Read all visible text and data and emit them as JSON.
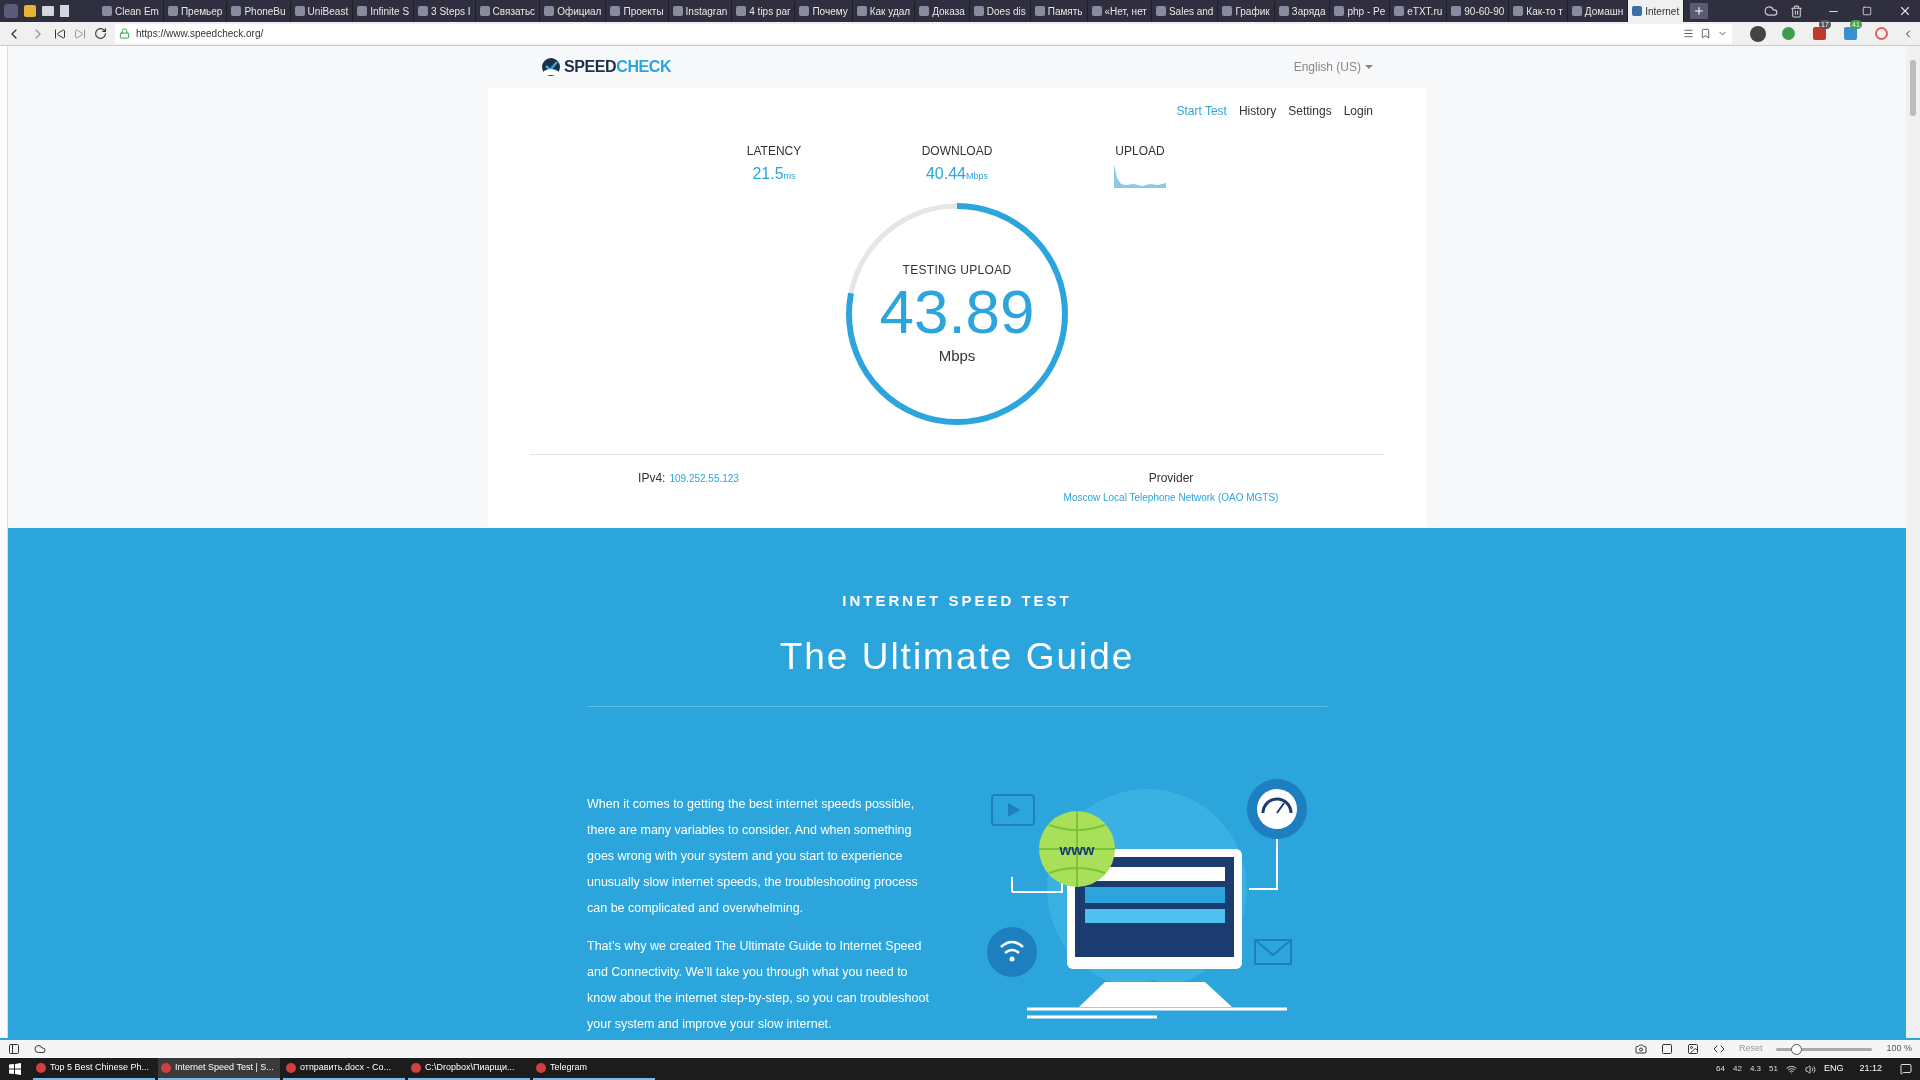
{
  "browser": {
    "tabs": [
      {
        "title": "Clean Em",
        "selected": false
      },
      {
        "title": "Премьер",
        "selected": false
      },
      {
        "title": "PhoneBu",
        "selected": false
      },
      {
        "title": "UniBeast",
        "selected": false
      },
      {
        "title": "Infinite S",
        "selected": false
      },
      {
        "title": "3 Steps I",
        "selected": false
      },
      {
        "title": "Связатьс",
        "selected": false
      },
      {
        "title": "Официал",
        "selected": false
      },
      {
        "title": "Проекты",
        "selected": false
      },
      {
        "title": "Instagran",
        "selected": false
      },
      {
        "title": "4 tips par",
        "selected": false
      },
      {
        "title": "Почему",
        "selected": false
      },
      {
        "title": "Как удал",
        "selected": false
      },
      {
        "title": "Доказа",
        "selected": false
      },
      {
        "title": "Does dis",
        "selected": false
      },
      {
        "title": "Память",
        "selected": false
      },
      {
        "title": "«Нет, нет",
        "selected": false
      },
      {
        "title": "Sales and",
        "selected": false
      },
      {
        "title": "График",
        "selected": false
      },
      {
        "title": "Заряда",
        "selected": false
      },
      {
        "title": "php - Pe",
        "selected": false
      },
      {
        "title": "eTXT.ru",
        "selected": false
      },
      {
        "title": "90-60-90",
        "selected": false
      },
      {
        "title": "Как-то т",
        "selected": false
      },
      {
        "title": "Домашн",
        "selected": false
      },
      {
        "title": "Internet",
        "selected": true
      }
    ],
    "url": "https://www.speedcheck.org/",
    "extension_badges": [
      "17",
      "41"
    ]
  },
  "page": {
    "logo": {
      "part_1": "SPEED",
      "part_2": "CHECK"
    },
    "language": "English (US)",
    "nav": [
      {
        "label": "Start Test",
        "selected": true
      },
      {
        "label": "History",
        "selected": false
      },
      {
        "label": "Settings",
        "selected": false
      },
      {
        "label": "Login",
        "selected": false
      }
    ],
    "metrics": [
      {
        "kind": "value",
        "label": "LATENCY",
        "value": "21.5",
        "unit": "ms"
      },
      {
        "kind": "value",
        "label": "DOWNLOAD",
        "value": "40.44",
        "unit": "Mbps"
      },
      {
        "kind": "graph",
        "label": "UPLOAD"
      }
    ],
    "gauge": {
      "caption": "TESTING UPLOAD",
      "value": "43.89",
      "unit": "Mbps",
      "level": 0.78
    },
    "ip": {
      "label": "IPv4:",
      "value": "109.252.55.123"
    },
    "provider": {
      "label": "Provider",
      "value": "Moscow Local Telephone Network (OAO MGTS)"
    },
    "guide": {
      "eyebrow": "INTERNET SPEED TEST",
      "title": "The Ultimate Guide",
      "paragraphs": [
        "When it comes to getting the best internet speeds possible, there are many variables to consider. And when something goes wrong with your system and you start to experience unusually slow internet speeds, the troubleshooting process can be complicated and overwhelming.",
        "That’s why we created The Ultimate Guide to Internet Speed and Connectivity. We’ll take you through what you need to know about the internet step-by-step, so you can troubleshoot your system and improve your slow internet."
      ],
      "illustration_label": "www"
    }
  },
  "status_bar": {
    "reset": "Reset",
    "zoom": "100 %",
    "level": 0.15
  },
  "taskbar": {
    "items": [
      {
        "title": "Top 5 Best Chinese Ph...",
        "selected": false
      },
      {
        "title": "Internet Speed Test | S...",
        "selected": true
      },
      {
        "title": "отправить.docx  -  Co...",
        "selected": false
      },
      {
        "title": "C:\\Dropbox\\Пиарщи...",
        "selected": false
      },
      {
        "title": "Telegram",
        "selected": false
      }
    ],
    "tray": [
      "64",
      "42",
      "4.3",
      "51"
    ],
    "language": "ENG",
    "time": "21:12"
  }
}
